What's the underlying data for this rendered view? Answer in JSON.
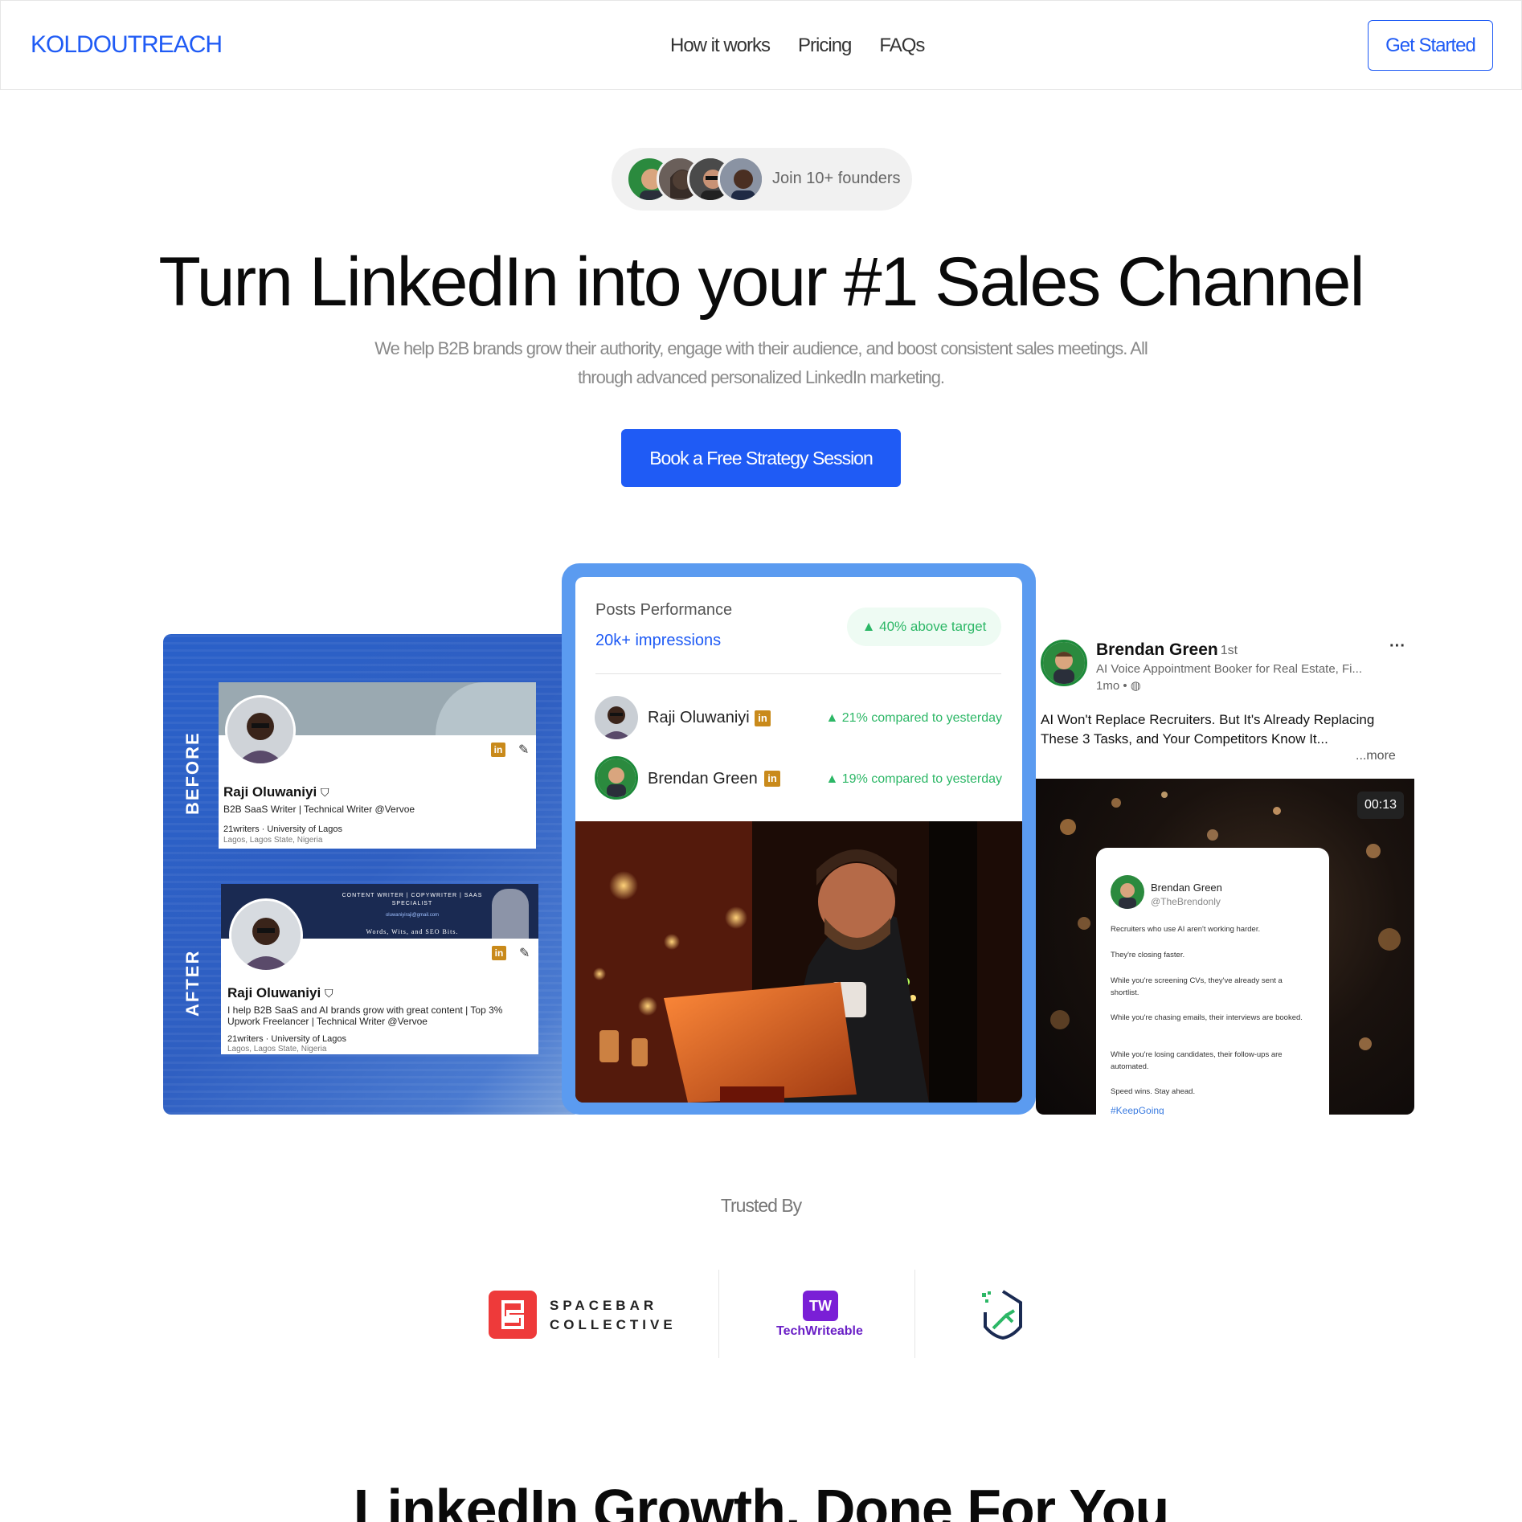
{
  "nav": {
    "brand": "KOLDOUTREACH",
    "links": [
      "How it works",
      "Pricing",
      "FAQs"
    ],
    "cta": "Get Started"
  },
  "hero": {
    "founders_text": "Join 10+ founders",
    "title": "Turn LinkedIn into your #1 Sales Channel",
    "subtitle": "We help B2B brands grow their authority, engage with their audience, and boost consistent sales meetings. All through advanced personalized LinkedIn marketing.",
    "cta": "Book a Free Strategy Session"
  },
  "before_after": {
    "before_label": "BEFORE",
    "after_label": "AFTER",
    "before": {
      "name": "Raji Oluwaniyi",
      "headline": "B2B SaaS Writer | Technical Writer @Vervoe",
      "company": "21writers · University of Lagos",
      "location": "Lagos, Lagos State, Nigeria"
    },
    "after": {
      "banner_line1": "CONTENT WRITER | COPYWRITER | SAAS",
      "banner_line2": "SPECIALIST",
      "banner_email": "oluwaniyiraji@gmail.com",
      "banner_tagline": "Words, Wits, and SEO Bits.",
      "name": "Raji Oluwaniyi",
      "headline": "I help B2B SaaS and AI brands grow with great content | Top 3% Upwork Freelancer | Technical Writer @Vervoe",
      "company": "21writers · University of Lagos",
      "location": "Lagos, Lagos State, Nigeria"
    }
  },
  "performance": {
    "title": "Posts Performance",
    "impressions": "20k+ impressions",
    "badge": "40%  above target",
    "rows": [
      {
        "name": "Raji Oluwaniyi",
        "stat": "21%  compared to yesterday"
      },
      {
        "name": "Brendan Green",
        "stat": "19%  compared to yesterday"
      }
    ]
  },
  "linkedin_post": {
    "name": "Brendan Green",
    "degree": "· 1st",
    "headline": "AI Voice Appointment Booker for Real Estate, Fi...",
    "time": "1mo •",
    "body": "AI Won't Replace Recruiters. But It's Already Replacing These 3 Tasks, and Your Competitors Know It...",
    "more": "...more",
    "timer": "00:13",
    "tweet": {
      "name": "Brendan Green",
      "handle": "@TheBrendonly",
      "lines": [
        "Recruiters who use AI aren't working harder.",
        "They're closing faster.",
        "While you're screening CVs, they've already sent a shortlist.",
        "While you're chasing emails, their interviews are booked.",
        "While you're losing candidates, their follow-ups are automated.",
        "Speed wins. Stay ahead."
      ],
      "hashtag": "#KeepGoing"
    }
  },
  "trusted": {
    "label": "Trusted By",
    "logos": [
      {
        "name": "SPACEBAR COLLECTIVE",
        "line1": "SPACEBAR",
        "line2": "COLLECTIVE"
      },
      {
        "name": "TechWriteable",
        "mark": "TW"
      },
      {
        "name": "shield-arrow-logo"
      }
    ]
  },
  "section2": {
    "title": "LinkedIn Growth, Done For You"
  },
  "colors": {
    "brand_blue": "#1f5bf5",
    "positive_green": "#2cb766",
    "linkedin_gold": "#c98a1b"
  }
}
